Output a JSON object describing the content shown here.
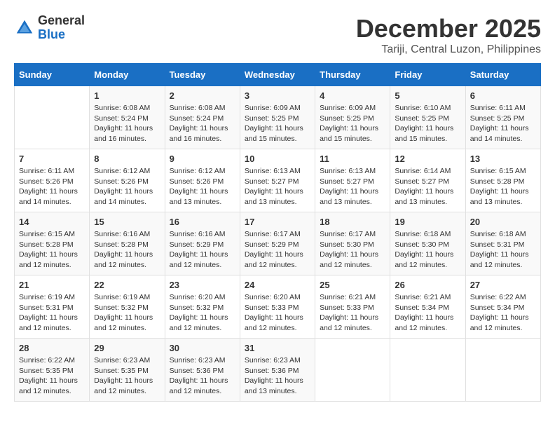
{
  "header": {
    "logo_general": "General",
    "logo_blue": "Blue",
    "month": "December 2025",
    "location": "Tariji, Central Luzon, Philippines"
  },
  "days_of_week": [
    "Sunday",
    "Monday",
    "Tuesday",
    "Wednesday",
    "Thursday",
    "Friday",
    "Saturday"
  ],
  "weeks": [
    [
      {
        "day": "",
        "info": ""
      },
      {
        "day": "1",
        "info": "Sunrise: 6:08 AM\nSunset: 5:24 PM\nDaylight: 11 hours\nand 16 minutes."
      },
      {
        "day": "2",
        "info": "Sunrise: 6:08 AM\nSunset: 5:24 PM\nDaylight: 11 hours\nand 16 minutes."
      },
      {
        "day": "3",
        "info": "Sunrise: 6:09 AM\nSunset: 5:25 PM\nDaylight: 11 hours\nand 15 minutes."
      },
      {
        "day": "4",
        "info": "Sunrise: 6:09 AM\nSunset: 5:25 PM\nDaylight: 11 hours\nand 15 minutes."
      },
      {
        "day": "5",
        "info": "Sunrise: 6:10 AM\nSunset: 5:25 PM\nDaylight: 11 hours\nand 15 minutes."
      },
      {
        "day": "6",
        "info": "Sunrise: 6:11 AM\nSunset: 5:25 PM\nDaylight: 11 hours\nand 14 minutes."
      }
    ],
    [
      {
        "day": "7",
        "info": "Sunrise: 6:11 AM\nSunset: 5:26 PM\nDaylight: 11 hours\nand 14 minutes."
      },
      {
        "day": "8",
        "info": "Sunrise: 6:12 AM\nSunset: 5:26 PM\nDaylight: 11 hours\nand 14 minutes."
      },
      {
        "day": "9",
        "info": "Sunrise: 6:12 AM\nSunset: 5:26 PM\nDaylight: 11 hours\nand 13 minutes."
      },
      {
        "day": "10",
        "info": "Sunrise: 6:13 AM\nSunset: 5:27 PM\nDaylight: 11 hours\nand 13 minutes."
      },
      {
        "day": "11",
        "info": "Sunrise: 6:13 AM\nSunset: 5:27 PM\nDaylight: 11 hours\nand 13 minutes."
      },
      {
        "day": "12",
        "info": "Sunrise: 6:14 AM\nSunset: 5:27 PM\nDaylight: 11 hours\nand 13 minutes."
      },
      {
        "day": "13",
        "info": "Sunrise: 6:15 AM\nSunset: 5:28 PM\nDaylight: 11 hours\nand 13 minutes."
      }
    ],
    [
      {
        "day": "14",
        "info": "Sunrise: 6:15 AM\nSunset: 5:28 PM\nDaylight: 11 hours\nand 12 minutes."
      },
      {
        "day": "15",
        "info": "Sunrise: 6:16 AM\nSunset: 5:28 PM\nDaylight: 11 hours\nand 12 minutes."
      },
      {
        "day": "16",
        "info": "Sunrise: 6:16 AM\nSunset: 5:29 PM\nDaylight: 11 hours\nand 12 minutes."
      },
      {
        "day": "17",
        "info": "Sunrise: 6:17 AM\nSunset: 5:29 PM\nDaylight: 11 hours\nand 12 minutes."
      },
      {
        "day": "18",
        "info": "Sunrise: 6:17 AM\nSunset: 5:30 PM\nDaylight: 11 hours\nand 12 minutes."
      },
      {
        "day": "19",
        "info": "Sunrise: 6:18 AM\nSunset: 5:30 PM\nDaylight: 11 hours\nand 12 minutes."
      },
      {
        "day": "20",
        "info": "Sunrise: 6:18 AM\nSunset: 5:31 PM\nDaylight: 11 hours\nand 12 minutes."
      }
    ],
    [
      {
        "day": "21",
        "info": "Sunrise: 6:19 AM\nSunset: 5:31 PM\nDaylight: 11 hours\nand 12 minutes."
      },
      {
        "day": "22",
        "info": "Sunrise: 6:19 AM\nSunset: 5:32 PM\nDaylight: 11 hours\nand 12 minutes."
      },
      {
        "day": "23",
        "info": "Sunrise: 6:20 AM\nSunset: 5:32 PM\nDaylight: 11 hours\nand 12 minutes."
      },
      {
        "day": "24",
        "info": "Sunrise: 6:20 AM\nSunset: 5:33 PM\nDaylight: 11 hours\nand 12 minutes."
      },
      {
        "day": "25",
        "info": "Sunrise: 6:21 AM\nSunset: 5:33 PM\nDaylight: 11 hours\nand 12 minutes."
      },
      {
        "day": "26",
        "info": "Sunrise: 6:21 AM\nSunset: 5:34 PM\nDaylight: 11 hours\nand 12 minutes."
      },
      {
        "day": "27",
        "info": "Sunrise: 6:22 AM\nSunset: 5:34 PM\nDaylight: 11 hours\nand 12 minutes."
      }
    ],
    [
      {
        "day": "28",
        "info": "Sunrise: 6:22 AM\nSunset: 5:35 PM\nDaylight: 11 hours\nand 12 minutes."
      },
      {
        "day": "29",
        "info": "Sunrise: 6:23 AM\nSunset: 5:35 PM\nDaylight: 11 hours\nand 12 minutes."
      },
      {
        "day": "30",
        "info": "Sunrise: 6:23 AM\nSunset: 5:36 PM\nDaylight: 11 hours\nand 12 minutes."
      },
      {
        "day": "31",
        "info": "Sunrise: 6:23 AM\nSunset: 5:36 PM\nDaylight: 11 hours\nand 13 minutes."
      },
      {
        "day": "",
        "info": ""
      },
      {
        "day": "",
        "info": ""
      },
      {
        "day": "",
        "info": ""
      }
    ]
  ]
}
